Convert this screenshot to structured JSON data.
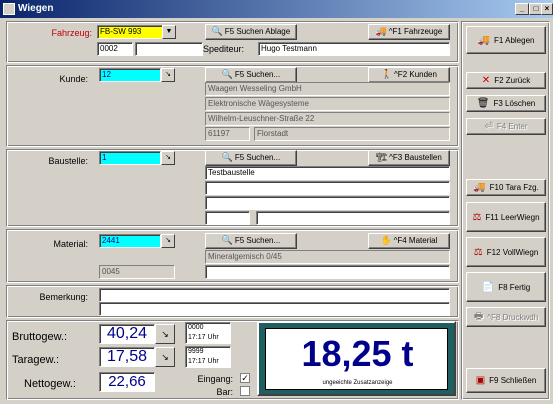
{
  "window": {
    "title": "Wiegen"
  },
  "fahrzeug": {
    "label": "Fahrzeug:",
    "value": "FB-SW 993",
    "number": "0002",
    "number_extra": "",
    "spediteur_label": "Spediteur:",
    "spediteur": "Hugo Testmann",
    "search_btn": "F5 Suchen Ablage",
    "f1_btn": "^F1 Fahrzeuge"
  },
  "kunde": {
    "label": "Kunde:",
    "value": "12",
    "search_btn": "F5 Suchen...",
    "f2_btn": "^F2 Kunden",
    "lines": [
      "Waagen Wesseling GmbH",
      "Elektronische Wägesysteme",
      "Wilhelm-Leuschner-Straße 22"
    ],
    "zip": "61197",
    "city": "Florstadt"
  },
  "baustelle": {
    "label": "Baustelle:",
    "value": "1",
    "search_btn": "F5 Suchen...",
    "f3_btn": "^F3 Baustellen",
    "line1": "Testbaustelle",
    "line2": "",
    "line3": "",
    "line4a": "",
    "line4b": ""
  },
  "material": {
    "label": "Material:",
    "value": "2441",
    "search_btn": "F5 Suchen...",
    "f4_btn": "^F4 Material",
    "description": "Mineralgemisch 0/45",
    "code": "0045",
    "extra": ""
  },
  "bemerkung": {
    "label": "Bemerkung:",
    "line1": "",
    "line2": ""
  },
  "weights": {
    "brutto_label": "Bruttogew.:",
    "brutto": "40,24",
    "brutto_id": "0000",
    "brutto_time": "17:17 Uhr",
    "tara_label": "Taragew.:",
    "tara": "17,58",
    "tara_id": "9999",
    "tara_time": "17:17 Uhr",
    "netto_label": "Nettogew.:",
    "netto": "22,66",
    "eingang_label": "Eingang:",
    "eingang_checked": "✓",
    "bar_label": "Bar:",
    "bar_checked": ""
  },
  "display": {
    "value": "18,25 t",
    "caption": "ungeeichte Zusatzanzeige"
  },
  "sidebar": {
    "f1": "F1 Ablegen",
    "f2": "F2 Zurück",
    "f3": "F3 Löschen",
    "f4": "F4 Enter",
    "f10": "F10 Tara Fzg.",
    "f11": "F11 LeerWiegn",
    "f12": "F12 VollWiegn",
    "f8": "F8 Fertig",
    "cf8": "^F8 Druckwdh",
    "f9": "F9 Schließen"
  }
}
